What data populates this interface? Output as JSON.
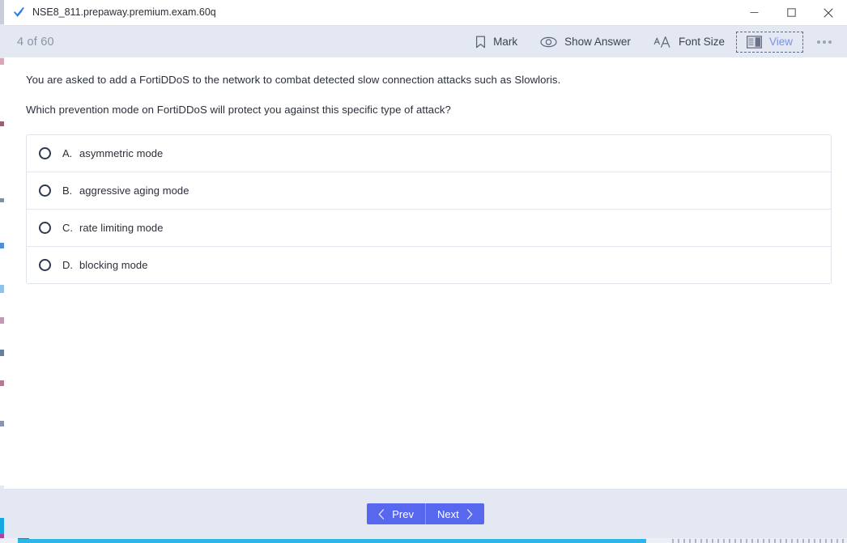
{
  "window": {
    "tab": {
      "icon": "check-icon",
      "title": "NSE8_811.prepaway.premium.exam.60q"
    },
    "controls": {
      "minimize": "minimize-icon",
      "maximize": "maximize-icon",
      "close": "close-icon"
    }
  },
  "toolbar": {
    "counter": "4 of 60",
    "actions": [
      {
        "id": "mark",
        "label": "Mark",
        "icon": "bookmark-icon",
        "active": false
      },
      {
        "id": "show-answer",
        "label": "Show Answer",
        "icon": "eye-icon",
        "active": false
      },
      {
        "id": "font-size",
        "label": "Font Size",
        "icon": "font-size-icon",
        "active": false
      },
      {
        "id": "view",
        "label": "View",
        "icon": "layout-panel-icon",
        "active": true
      }
    ],
    "more": "more-options-icon"
  },
  "question": {
    "prompt_line_1": "You are asked to add a FortiDDoS to the network to combat detected slow connection attacks such as Slowloris.",
    "prompt_line_2": "Which prevention mode on FortiDDoS will protect you against this specific type of attack?",
    "options": [
      {
        "letter": "A.",
        "text": "asymmetric mode",
        "selected": false
      },
      {
        "letter": "B.",
        "text": "aggressive aging mode",
        "selected": false
      },
      {
        "letter": "C.",
        "text": "rate limiting mode",
        "selected": false
      },
      {
        "letter": "D.",
        "text": "blocking mode",
        "selected": false
      }
    ]
  },
  "footer": {
    "prev_label": "Prev",
    "next_label": "Next"
  },
  "colors": {
    "toolbar_bg": "#e3e8f3",
    "nav_button": "#5768ef",
    "active_tool_text": "#7b90f0",
    "counter_text": "#8b93a5",
    "radio_outline": "#2f3a4e"
  }
}
